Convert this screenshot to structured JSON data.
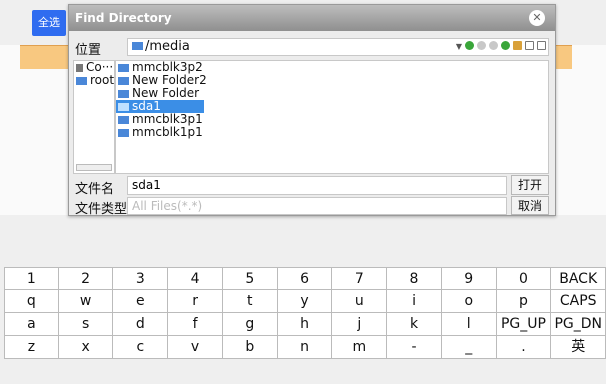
{
  "select_all_label": "全选",
  "dialog": {
    "title": "Find Directory",
    "location_label": "位置",
    "path": "/media",
    "left_items": [
      "Co···",
      "root"
    ],
    "files": [
      "mmcblk3p2",
      "New Folder2",
      "New Folder",
      "sda1",
      "mmcblk3p1",
      "mmcblk1p1"
    ],
    "selected_file": "sda1",
    "filename_label": "文件名",
    "filename_value": "sda1",
    "filetype_label": "文件类型",
    "filetype_value": "All Files(*.*)",
    "open_label": "打开",
    "cancel_label": "取消"
  },
  "keyboard": {
    "rows": [
      [
        "1",
        "2",
        "3",
        "4",
        "5",
        "6",
        "7",
        "8",
        "9",
        "0",
        "BACK"
      ],
      [
        "q",
        "w",
        "e",
        "r",
        "t",
        "y",
        "u",
        "i",
        "o",
        "p",
        "CAPS"
      ],
      [
        "a",
        "s",
        "d",
        "f",
        "g",
        "h",
        "j",
        "k",
        "l",
        "PG_UP",
        "PG_DN"
      ],
      [
        "z",
        "x",
        "c",
        "v",
        "b",
        "n",
        "m",
        "-",
        "_",
        ".",
        "英"
      ]
    ]
  }
}
